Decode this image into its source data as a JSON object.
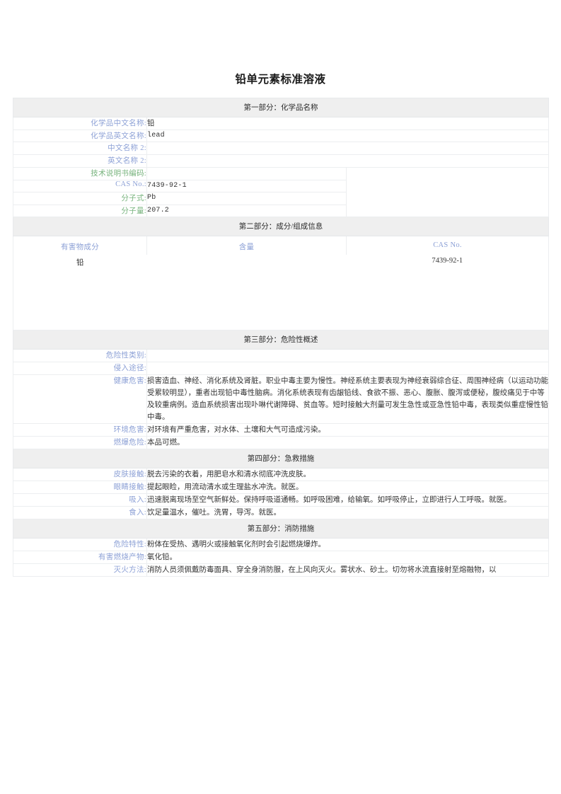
{
  "document": {
    "title": "铅单元素标准溶液"
  },
  "colors": {
    "label_blue": "#8da1d6",
    "label_green": "#79b47f",
    "section_header_bg": "#efefef",
    "border": "#eceef0",
    "text": "#333333"
  },
  "sections": [
    {
      "id": "section-1",
      "header": "第一部分：化学品名称",
      "rows": [
        {
          "label": "化学品中文名称:",
          "label_color": "blue",
          "value": "铅",
          "split": false
        },
        {
          "label": "化学品英文名称:",
          "label_color": "blue",
          "value": "lead",
          "split": false
        },
        {
          "label": "中文名称 2:",
          "label_color": "blue",
          "value": "",
          "split": false
        },
        {
          "label": "英文名称 2:",
          "label_color": "blue",
          "value": "",
          "split": false
        },
        {
          "label": "技术说明书编码:",
          "label_color": "green",
          "value": "",
          "split": true
        },
        {
          "label": "CAS No.:",
          "label_color": "blue",
          "value": "7439-92-1",
          "split": true
        },
        {
          "label": "分子式:",
          "label_color": "green",
          "value": "Pb",
          "split": true
        },
        {
          "label": "分子量:",
          "label_color": "green",
          "value": "207.2",
          "split": true
        }
      ]
    },
    {
      "id": "section-2",
      "header": "第二部分：成分/组成信息",
      "columns": [
        "有害物成分",
        "含量",
        "CAS No."
      ],
      "rows": [
        {
          "component": "铅",
          "content": "",
          "cas": "7439-92-1"
        }
      ]
    },
    {
      "id": "section-3",
      "header": "第三部分：危险性概述",
      "rows": [
        {
          "label": "危险性类别:",
          "label_color": "blue",
          "value": ""
        },
        {
          "label": "侵入途径:",
          "label_color": "blue",
          "value": ""
        },
        {
          "label": "健康危害:",
          "label_color": "blue",
          "value": "损害造血、神经、消化系统及肾脏。职业中毒主要为慢性。神经系统主要表现为神经衰弱综合征、周围神经病（以运动功能受累较明显），重者出现铅中毒性脑病。消化系统表现有齿龈铅线、食欲不振、恶心、腹胀、腹泻或便秘，腹绞痛见于中等及较重病例。造血系统损害出现卟啉代谢障碍、贫血等。短时接触大剂量可发生急性或亚急性铅中毒，表现类似重症慢性铅中毒。"
        },
        {
          "label": "环境危害:",
          "label_color": "blue",
          "value": "对环境有严重危害，对水体、土壤和大气可造成污染。"
        },
        {
          "label": "燃爆危险:",
          "label_color": "blue",
          "value": "本品可燃。"
        }
      ]
    },
    {
      "id": "section-4",
      "header": "第四部分：急救措施",
      "rows": [
        {
          "label": "皮肤接触:",
          "label_color": "blue",
          "value": "脱去污染的衣着，用肥皂水和清水彻底冲洗皮肤。"
        },
        {
          "label": "眼睛接触:",
          "label_color": "blue",
          "value": "提起眼睑，用流动清水或生理盐水冲洗。就医。"
        },
        {
          "label": "吸入:",
          "label_color": "blue",
          "value": "迅速脱离现场至空气新鲜处。保持呼吸道通畅。如呼吸困难，给输氧。如呼吸停止，立即进行人工呼吸。就医。"
        },
        {
          "label": "食入:",
          "label_color": "blue",
          "value": "饮足量温水，催吐。洗胃，导泻。就医。"
        }
      ]
    },
    {
      "id": "section-5",
      "header": "第五部分：消防措施",
      "rows": [
        {
          "label": "危险特性:",
          "label_color": "blue",
          "value": "粉体在受热、遇明火或接触氧化剂时会引起燃烧爆炸。"
        },
        {
          "label": "有害燃烧产物:",
          "label_color": "blue",
          "value": "氧化铅。"
        },
        {
          "label": "灭火方法:",
          "label_color": "blue",
          "value": "消防人员须佩戴防毒面具、穿全身消防服，在上风向灭火。雾状水、砂土。切勿将水流直接射至熔融物，以"
        }
      ]
    }
  ]
}
